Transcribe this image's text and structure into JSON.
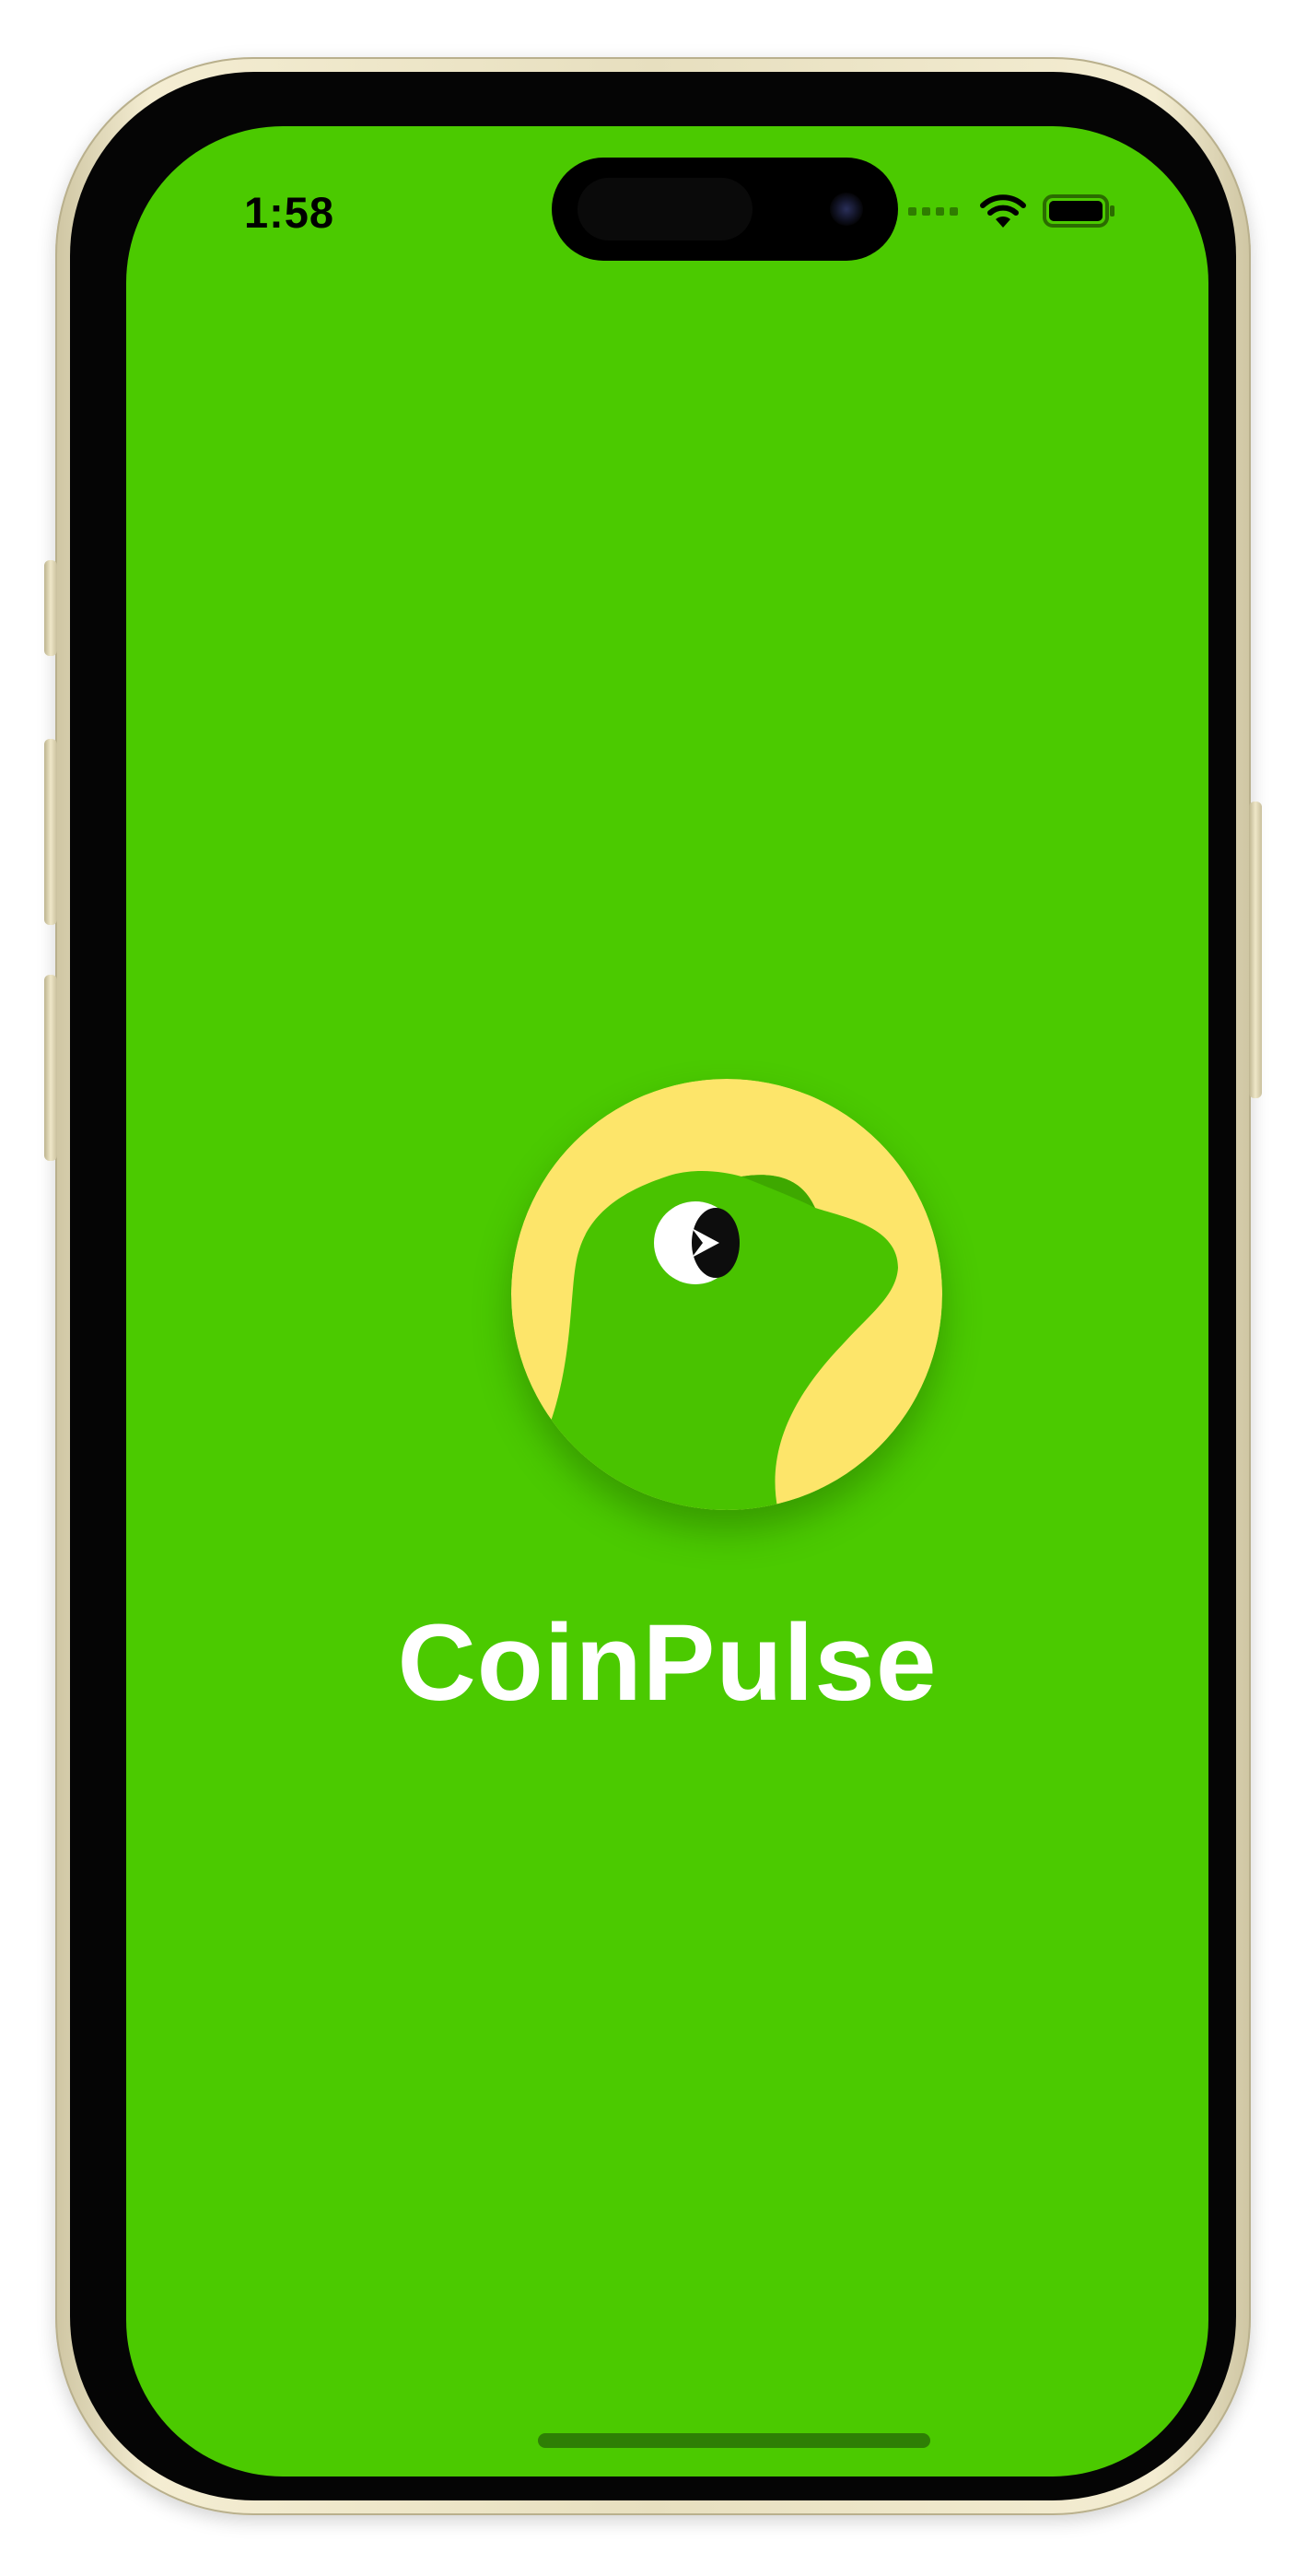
{
  "status_bar": {
    "time": "1:58",
    "wifi_icon": "wifi-icon",
    "battery_icon": "battery-icon"
  },
  "splash": {
    "logo_icon": "frog-coin-logo-icon",
    "app_name": "CoinPulse"
  },
  "colors": {
    "screen_background": "#4bca00",
    "logo_background": "#fde56a",
    "text": "#ffffff"
  }
}
